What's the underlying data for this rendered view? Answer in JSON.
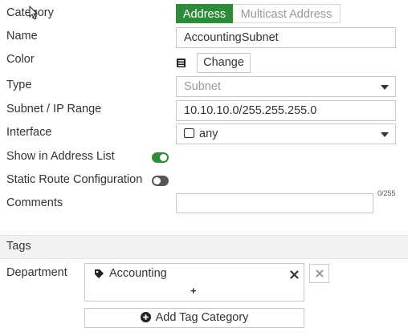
{
  "form": {
    "category": {
      "label": "Category",
      "options": [
        "Address",
        "Multicast Address"
      ],
      "selected": "Address"
    },
    "name": {
      "label": "Name",
      "value": "AccountingSubnet"
    },
    "color": {
      "label": "Color",
      "button_label": "Change",
      "icon": "color-swatch-icon"
    },
    "type": {
      "label": "Type",
      "value": "Subnet",
      "disabled": true
    },
    "subnet": {
      "label": "Subnet / IP Range",
      "value": "10.10.10.0/255.255.255.0"
    },
    "interface": {
      "label": "Interface",
      "value": "any",
      "icon": "interface-port-icon"
    },
    "show_in_address_list": {
      "label": "Show in Address List",
      "enabled": true
    },
    "static_route": {
      "label": "Static Route Configuration",
      "enabled": false
    },
    "comments": {
      "label": "Comments",
      "value": "",
      "counter": "0/255"
    }
  },
  "tags": {
    "section_title": "Tags",
    "categories": [
      {
        "label": "Department",
        "tags": [
          "Accounting"
        ],
        "add_glyph": "+"
      }
    ],
    "add_category_label": "Add Tag Category"
  },
  "colors": {
    "accent": "#2e8b3a",
    "toggle_off": "#555555",
    "border": "#c8c8c8",
    "section_bg": "#f3f3f3"
  }
}
